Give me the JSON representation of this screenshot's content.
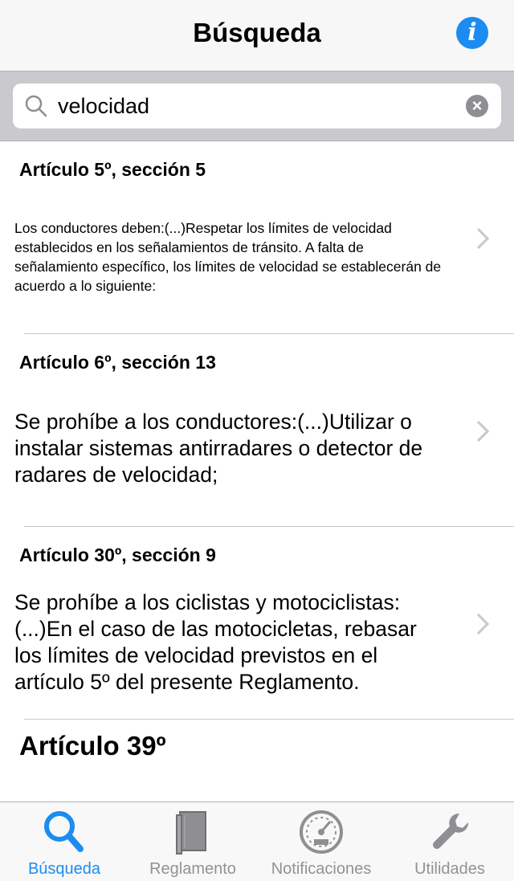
{
  "nav": {
    "title": "Búsqueda",
    "info_icon": "info-icon"
  },
  "search": {
    "value": "velocidad",
    "placeholder": ""
  },
  "results": [
    {
      "title": "Artículo 5º, sección 5",
      "body": "Los conductores deben:(...)Respetar los límites de velocidad establecidos en los señalamientos de tránsito. A falta de señalamiento específico, los límites de velocidad se establecerán de acuerdo a lo siguiente:"
    },
    {
      "title": "Artículo 6º, sección 13",
      "body": "Se prohíbe a los conductores:(...)Utilizar o instalar sistemas antirradares o detector de radares de velocidad;"
    },
    {
      "title": "Artículo 30º, sección 9",
      "body": "Se prohíbe a los ciclistas y motociclistas:(...)En el caso de las motocicletas, rebasar los límites de velocidad previstos en el artículo 5º del presente Reglamento."
    },
    {
      "title": "Artículo 39º",
      "body": ""
    }
  ],
  "tabs": [
    {
      "label": "Búsqueda",
      "icon": "search-icon",
      "active": true
    },
    {
      "label": "Reglamento",
      "icon": "book-icon",
      "active": false
    },
    {
      "label": "Notificaciones",
      "icon": "speedometer-icon",
      "active": false
    },
    {
      "label": "Utilidades",
      "icon": "wrench-icon",
      "active": false
    }
  ],
  "colors": {
    "accent": "#1a8cf2",
    "inactive": "#929292",
    "separator": "#c8c7cc"
  }
}
